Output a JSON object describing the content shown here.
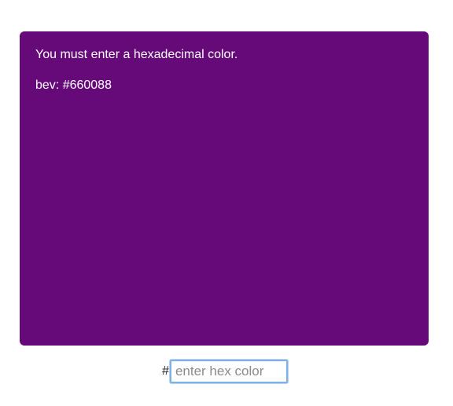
{
  "panel": {
    "background": "#660a7a",
    "error_message": "You must enter a hexadecimal color.",
    "color_line": "bev: #660088"
  },
  "input": {
    "prefix": "#",
    "value": "",
    "placeholder": "enter hex color"
  }
}
